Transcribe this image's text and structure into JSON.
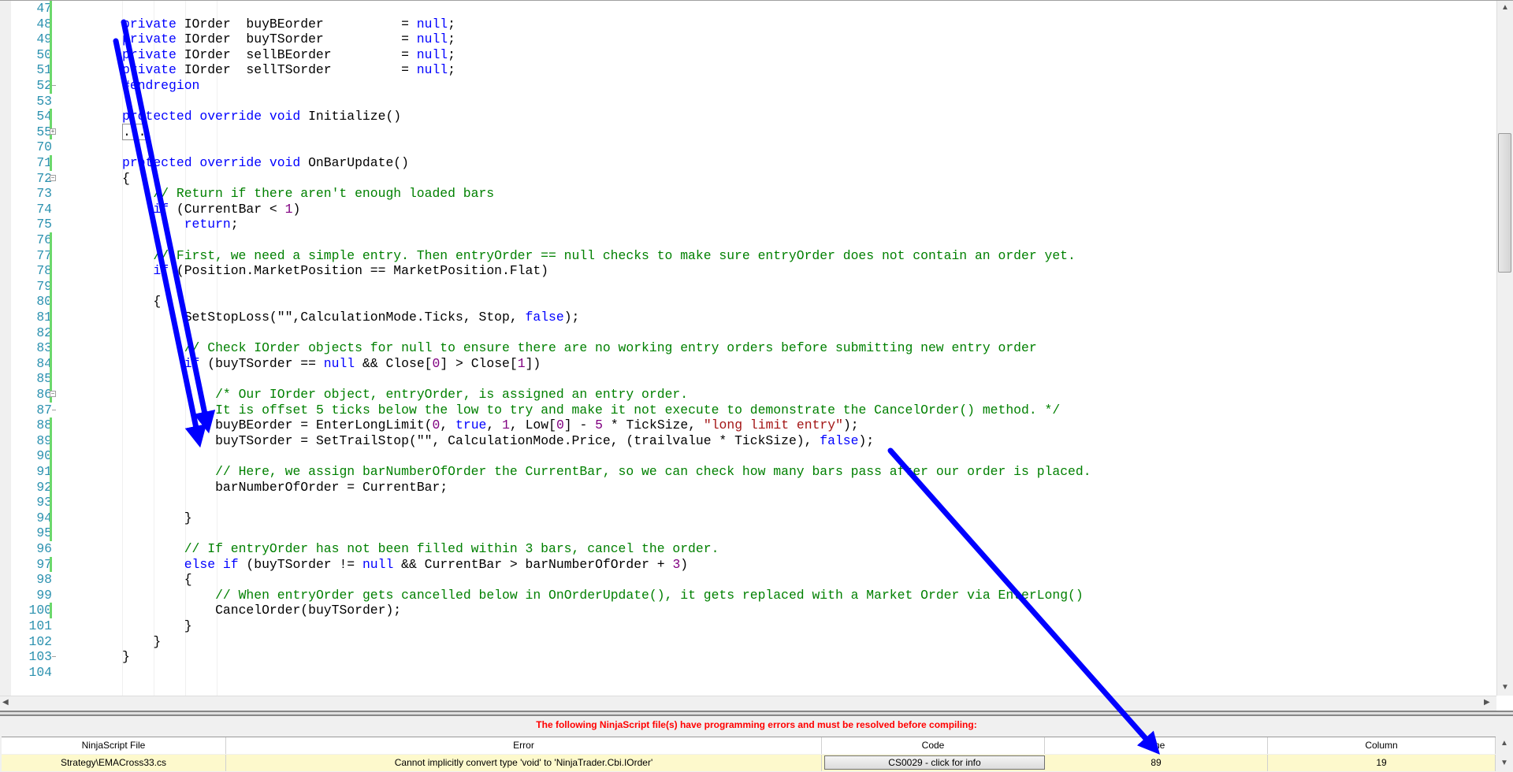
{
  "editor": {
    "lines": [
      {
        "n": "47",
        "indent": 0,
        "chg": true,
        "tokens": []
      },
      {
        "n": "48",
        "indent": 0,
        "chg": true,
        "tokens": [
          [
            "kw",
            "private "
          ],
          [
            "pl",
            "IOrder  buyBEorder          = "
          ],
          [
            "kw",
            "null"
          ],
          [
            "pl",
            ";"
          ]
        ]
      },
      {
        "n": "49",
        "indent": 0,
        "chg": true,
        "tokens": [
          [
            "kw",
            "private "
          ],
          [
            "pl",
            "IOrder  buyTSorder          = "
          ],
          [
            "kw",
            "null"
          ],
          [
            "pl",
            ";"
          ]
        ]
      },
      {
        "n": "50",
        "indent": 0,
        "chg": true,
        "tokens": [
          [
            "kw",
            "private "
          ],
          [
            "pl",
            "IOrder  sellBEorder         = "
          ],
          [
            "kw",
            "null"
          ],
          [
            "pl",
            ";"
          ]
        ]
      },
      {
        "n": "51",
        "indent": 0,
        "chg": true,
        "tokens": [
          [
            "kw",
            "private "
          ],
          [
            "pl",
            "IOrder  sellTSorder         = "
          ],
          [
            "kw",
            "null"
          ],
          [
            "pl",
            ";"
          ]
        ]
      },
      {
        "n": "52",
        "indent": 0,
        "chg": true,
        "fold": "end",
        "tokens": [
          [
            "kw",
            "#endregion"
          ]
        ]
      },
      {
        "n": "53",
        "indent": 0,
        "chg": false,
        "tokens": []
      },
      {
        "n": "54",
        "indent": 0,
        "chg": true,
        "tokens": [
          [
            "kw",
            "protected override void "
          ],
          [
            "pl",
            "Initialize()"
          ]
        ]
      },
      {
        "n": "55",
        "indent": 0,
        "chg": true,
        "fold": "plus",
        "tokens": [
          [
            "collapsed",
            "..."
          ]
        ]
      },
      {
        "n": "70",
        "indent": 0,
        "chg": false,
        "tokens": []
      },
      {
        "n": "71",
        "indent": 0,
        "chg": true,
        "tokens": [
          [
            "kw",
            "protected override void "
          ],
          [
            "pl",
            "OnBarUpdate()"
          ]
        ]
      },
      {
        "n": "72",
        "indent": 0,
        "chg": false,
        "fold": "minus",
        "tokens": [
          [
            "pl",
            "{"
          ]
        ]
      },
      {
        "n": "73",
        "indent": 1,
        "chg": false,
        "tokens": [
          [
            "cm",
            "// Return if there aren't enough loaded bars"
          ]
        ]
      },
      {
        "n": "74",
        "indent": 1,
        "chg": false,
        "tokens": [
          [
            "kw",
            "if "
          ],
          [
            "pl",
            "(CurrentBar < "
          ],
          [
            "nu",
            "1"
          ],
          [
            "pl",
            ")"
          ]
        ]
      },
      {
        "n": "75",
        "indent": 2,
        "chg": false,
        "tokens": [
          [
            "kw",
            "return"
          ],
          [
            "pl",
            ";"
          ]
        ]
      },
      {
        "n": "76",
        "indent": 0,
        "chg": true,
        "tokens": []
      },
      {
        "n": "77",
        "indent": 1,
        "chg": true,
        "tokens": [
          [
            "cm",
            "// First, we need a simple entry. Then entryOrder == null checks to make sure entryOrder does not contain an order yet."
          ]
        ]
      },
      {
        "n": "78",
        "indent": 1,
        "chg": true,
        "tokens": [
          [
            "kw",
            "if "
          ],
          [
            "pl",
            "(Position.MarketPosition == MarketPosition.Flat)"
          ]
        ]
      },
      {
        "n": "79",
        "indent": 0,
        "chg": true,
        "tokens": []
      },
      {
        "n": "80",
        "indent": 1,
        "chg": true,
        "tokens": [
          [
            "pl",
            "{"
          ]
        ]
      },
      {
        "n": "81",
        "indent": 2,
        "chg": true,
        "tokens": [
          [
            "pl",
            "SetStopLoss(\"\",CalculationMode.Ticks, Stop, "
          ],
          [
            "kw",
            "false"
          ],
          [
            "pl",
            ");"
          ]
        ]
      },
      {
        "n": "82",
        "indent": 0,
        "chg": true,
        "tokens": []
      },
      {
        "n": "83",
        "indent": 2,
        "chg": true,
        "tokens": [
          [
            "cm",
            "// Check IOrder objects for null to ensure there are no working entry orders before submitting new entry order"
          ]
        ]
      },
      {
        "n": "84",
        "indent": 2,
        "chg": true,
        "tokens": [
          [
            "kw",
            "if "
          ],
          [
            "pl",
            "(buyTSorder == "
          ],
          [
            "kw",
            "null"
          ],
          [
            "pl",
            " && Close["
          ],
          [
            "nu",
            "0"
          ],
          [
            "pl",
            "] > Close["
          ],
          [
            "nu",
            "1"
          ],
          [
            "pl",
            "])"
          ]
        ]
      },
      {
        "n": "85",
        "indent": 0,
        "chg": true,
        "tokens": []
      },
      {
        "n": "86",
        "indent": 3,
        "chg": true,
        "fold": "minus",
        "tokens": [
          [
            "cm",
            "/* Our IOrder object, entryOrder, is assigned an entry order."
          ]
        ]
      },
      {
        "n": "87",
        "indent": 3,
        "chg": false,
        "fold": "end",
        "tokens": [
          [
            "cm",
            "It is offset 5 ticks below the low to try and make it not execute to demonstrate the CancelOrder() method. */"
          ]
        ]
      },
      {
        "n": "88",
        "indent": 3,
        "chg": true,
        "tokens": [
          [
            "pl",
            "buyBEorder = EnterLongLimit("
          ],
          [
            "nu",
            "0"
          ],
          [
            "pl",
            ", "
          ],
          [
            "kw",
            "true"
          ],
          [
            "pl",
            ", "
          ],
          [
            "nu",
            "1"
          ],
          [
            "pl",
            ", Low["
          ],
          [
            "nu",
            "0"
          ],
          [
            "pl",
            "] - "
          ],
          [
            "nu",
            "5"
          ],
          [
            "pl",
            " * TickSize, "
          ],
          [
            "st",
            "\"long limit entry\""
          ],
          [
            "pl",
            ");"
          ]
        ]
      },
      {
        "n": "89",
        "indent": 3,
        "chg": true,
        "tokens": [
          [
            "pl",
            "buyTSorder = SetTrailStop(\"\", CalculationMode.Price, (trailvalue * TickSize), "
          ],
          [
            "kw",
            "false"
          ],
          [
            "pl",
            ");"
          ]
        ]
      },
      {
        "n": "90",
        "indent": 0,
        "chg": true,
        "tokens": []
      },
      {
        "n": "91",
        "indent": 3,
        "chg": true,
        "tokens": [
          [
            "cm",
            "// Here, we assign barNumberOfOrder the CurrentBar, so we can check how many bars pass after our order is placed."
          ]
        ]
      },
      {
        "n": "92",
        "indent": 3,
        "chg": true,
        "tokens": [
          [
            "pl",
            "barNumberOfOrder = CurrentBar;"
          ]
        ]
      },
      {
        "n": "93",
        "indent": 0,
        "chg": true,
        "tokens": []
      },
      {
        "n": "94",
        "indent": 2,
        "chg": true,
        "tokens": [
          [
            "pl",
            "}"
          ]
        ]
      },
      {
        "n": "95",
        "indent": 0,
        "chg": true,
        "tokens": []
      },
      {
        "n": "96",
        "indent": 2,
        "chg": false,
        "tokens": [
          [
            "cm",
            "// If entryOrder has not been filled within 3 bars, cancel the order."
          ]
        ]
      },
      {
        "n": "97",
        "indent": 2,
        "chg": true,
        "tokens": [
          [
            "kw",
            "else if "
          ],
          [
            "pl",
            "(buyTSorder != "
          ],
          [
            "kw",
            "null"
          ],
          [
            "pl",
            " && CurrentBar > barNumberOfOrder + "
          ],
          [
            "nu",
            "3"
          ],
          [
            "pl",
            ")"
          ]
        ]
      },
      {
        "n": "98",
        "indent": 2,
        "chg": false,
        "tokens": [
          [
            "pl",
            "{"
          ]
        ]
      },
      {
        "n": "99",
        "indent": 3,
        "chg": false,
        "tokens": [
          [
            "cm",
            "// When entryOrder gets cancelled below in OnOrderUpdate(), it gets replaced with a Market Order via EnterLong()"
          ]
        ]
      },
      {
        "n": "100",
        "indent": 3,
        "chg": true,
        "tokens": [
          [
            "pl",
            "CancelOrder(buyTSorder);"
          ]
        ]
      },
      {
        "n": "101",
        "indent": 2,
        "chg": false,
        "tokens": [
          [
            "pl",
            "}"
          ]
        ]
      },
      {
        "n": "102",
        "indent": 1,
        "chg": false,
        "tokens": [
          [
            "pl",
            "}"
          ]
        ]
      },
      {
        "n": "103",
        "indent": 0,
        "chg": false,
        "fold": "end",
        "tokens": [
          [
            "pl",
            "}"
          ]
        ]
      },
      {
        "n": "104",
        "indent": 0,
        "chg": false,
        "tokens": []
      }
    ]
  },
  "errors": {
    "message": "The following NinjaScript file(s) have programming errors and must be resolved before compiling:",
    "columns": [
      "NinjaScript File",
      "Error",
      "Code",
      "Line",
      "Column"
    ],
    "rows": [
      {
        "file": "Strategy\\EMACross33.cs",
        "error": "Cannot implicitly convert type 'void' to 'NinjaTrader.Cbi.IOrder'",
        "code": "CS0029 - click for info",
        "line": "89",
        "column": "19"
      }
    ]
  },
  "colors": {
    "keyword": "#0000ff",
    "comment": "#008000",
    "number": "#800080",
    "string": "#a31515",
    "line_number": "#2b91af",
    "error_text": "#ff0000",
    "annotation_arrow": "#0000ff",
    "error_row": "#fdf9cc"
  }
}
